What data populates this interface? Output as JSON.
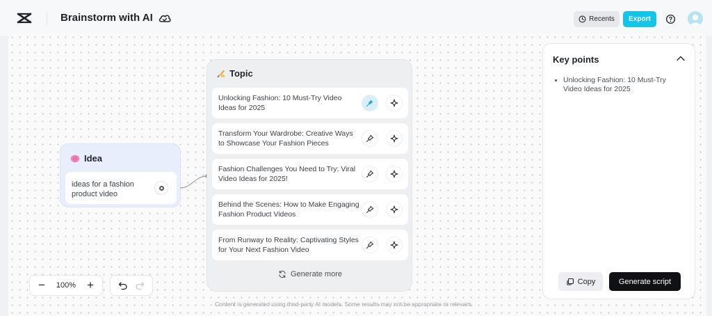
{
  "app": {
    "title": "Brainstorm with AI"
  },
  "header": {
    "recents_label": "Recents",
    "export_label": "Export"
  },
  "idea": {
    "title": "Idea",
    "text": "ideas for a fashion product video"
  },
  "topic": {
    "title": "Topic",
    "items": [
      {
        "text": "Unlocking Fashion: 10 Must-Try Video Ideas for 2025",
        "pinned": true
      },
      {
        "text": "Transform Your Wardrobe: Creative Ways to Showcase Your Fashion Pieces",
        "pinned": false
      },
      {
        "text": "Fashion Challenges You Need to Try: Viral Video Ideas for 2025!",
        "pinned": false
      },
      {
        "text": "Behind the Scenes: How to Make Engaging Fashion Product Videos",
        "pinned": false
      },
      {
        "text": "From Runway to Reality: Captivating Styles for Your Next Fashion Video",
        "pinned": false
      }
    ],
    "generate_more_label": "Generate more"
  },
  "toolbar": {
    "zoom_level": "100%"
  },
  "disclaimer": "Content is generated using third-party AI models. Some results may not be appropriate or relevant.",
  "key_points": {
    "title": "Key points",
    "items": [
      "Unlocking Fashion: 10 Must-Try Video Ideas for 2025"
    ],
    "copy_label": "Copy",
    "generate_script_label": "Generate script"
  },
  "colors": {
    "accent": "#12c4e6",
    "pin_active_bg": "#d9f0fb",
    "dark_button": "#101114"
  }
}
